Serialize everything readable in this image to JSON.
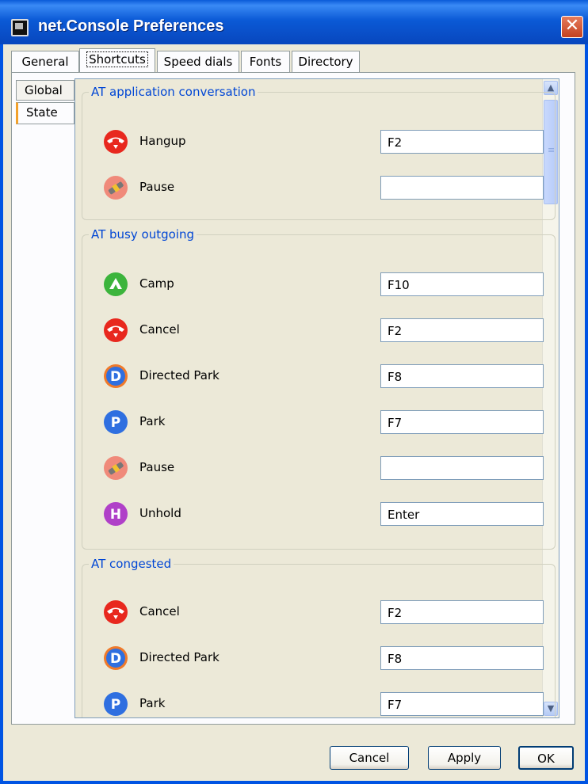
{
  "window": {
    "title": "net.Console Preferences"
  },
  "tabs": [
    {
      "label": "General"
    },
    {
      "label": "Shortcuts"
    },
    {
      "label": "Speed dials"
    },
    {
      "label": "Fonts"
    },
    {
      "label": "Directory"
    }
  ],
  "side_tabs": [
    {
      "label": "Global"
    },
    {
      "label": "State"
    }
  ],
  "groups": [
    {
      "title": "AT application conversation",
      "rows": [
        {
          "icon": "hangup-icon",
          "label": "Hangup",
          "value": "F2"
        },
        {
          "icon": "pause-icon",
          "label": "Pause",
          "value": ""
        }
      ]
    },
    {
      "title": "AT busy outgoing",
      "rows": [
        {
          "icon": "camp-icon",
          "label": "Camp",
          "value": "F10"
        },
        {
          "icon": "hangup-icon",
          "label": "Cancel",
          "value": "F2"
        },
        {
          "icon": "directed-park-icon",
          "label": "Directed Park",
          "value": "F8"
        },
        {
          "icon": "park-icon",
          "label": "Park",
          "value": "F7"
        },
        {
          "icon": "pause-icon",
          "label": "Pause",
          "value": ""
        },
        {
          "icon": "unhold-icon",
          "label": "Unhold",
          "value": "Enter"
        }
      ]
    },
    {
      "title": "AT congested",
      "rows": [
        {
          "icon": "hangup-icon",
          "label": "Cancel",
          "value": "F2"
        },
        {
          "icon": "directed-park-icon",
          "label": "Directed Park",
          "value": "F8"
        },
        {
          "icon": "park-icon",
          "label": "Park",
          "value": "F7"
        }
      ]
    }
  ],
  "buttons": {
    "cancel": "Cancel",
    "apply": "Apply",
    "ok": "OK"
  },
  "colors": {
    "titlebar": "#0a5bd8",
    "group_title": "#0046d5",
    "dialog_bg": "#ece9d8"
  }
}
